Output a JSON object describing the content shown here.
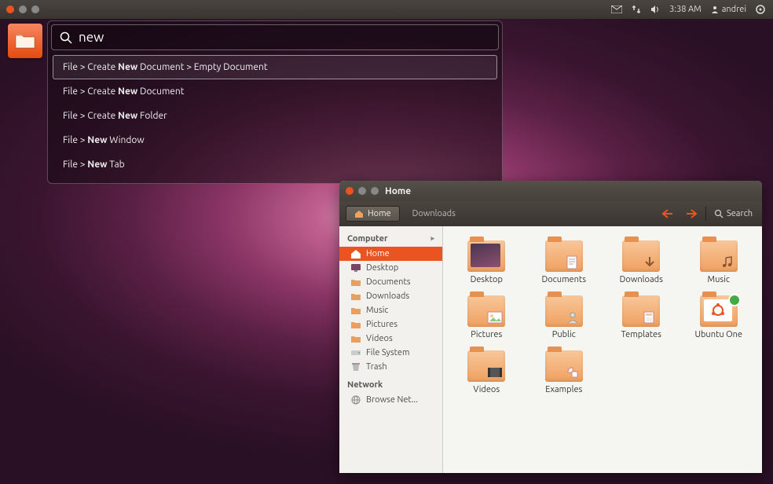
{
  "panel": {
    "time": "3:38 AM",
    "user": "andrei"
  },
  "hud": {
    "query": "new",
    "results": [
      {
        "pre": "File > Create ",
        "bold": "New",
        "post": " Document > Empty Document",
        "selected": true
      },
      {
        "pre": "File > Create ",
        "bold": "New",
        "post": " Document",
        "selected": false
      },
      {
        "pre": "File > Create ",
        "bold": "New",
        "post": " Folder",
        "selected": false
      },
      {
        "pre": "File > ",
        "bold": "New",
        "post": " Window",
        "selected": false
      },
      {
        "pre": "File > ",
        "bold": "New",
        "post": " Tab",
        "selected": false
      }
    ]
  },
  "nautilus": {
    "title": "Home",
    "toolbar": {
      "crumb_home": "Home",
      "crumb_downloads": "Downloads",
      "search": "Search"
    },
    "sidebar": {
      "sec_computer": "Computer",
      "sec_network": "Network",
      "items_computer": [
        {
          "label": "Home",
          "active": true,
          "icon": "home"
        },
        {
          "label": "Desktop",
          "active": false,
          "icon": "desktop"
        },
        {
          "label": "Documents",
          "active": false,
          "icon": "folder"
        },
        {
          "label": "Downloads",
          "active": false,
          "icon": "folder"
        },
        {
          "label": "Music",
          "active": false,
          "icon": "folder"
        },
        {
          "label": "Pictures",
          "active": false,
          "icon": "folder"
        },
        {
          "label": "Videos",
          "active": false,
          "icon": "folder"
        },
        {
          "label": "File System",
          "active": false,
          "icon": "drive"
        },
        {
          "label": "Trash",
          "active": false,
          "icon": "trash"
        }
      ],
      "items_network": [
        {
          "label": "Browse Net...",
          "active": false,
          "icon": "net"
        }
      ]
    },
    "folders": [
      {
        "label": "Desktop",
        "variant": "desktop"
      },
      {
        "label": "Documents",
        "variant": "doc"
      },
      {
        "label": "Downloads",
        "variant": "down"
      },
      {
        "label": "Music",
        "variant": "music"
      },
      {
        "label": "Pictures",
        "variant": "pic"
      },
      {
        "label": "Public",
        "variant": "public"
      },
      {
        "label": "Templates",
        "variant": "tpl"
      },
      {
        "label": "Ubuntu One",
        "variant": "ubuntu"
      },
      {
        "label": "Videos",
        "variant": "video"
      },
      {
        "label": "Examples",
        "variant": "ex"
      }
    ]
  }
}
